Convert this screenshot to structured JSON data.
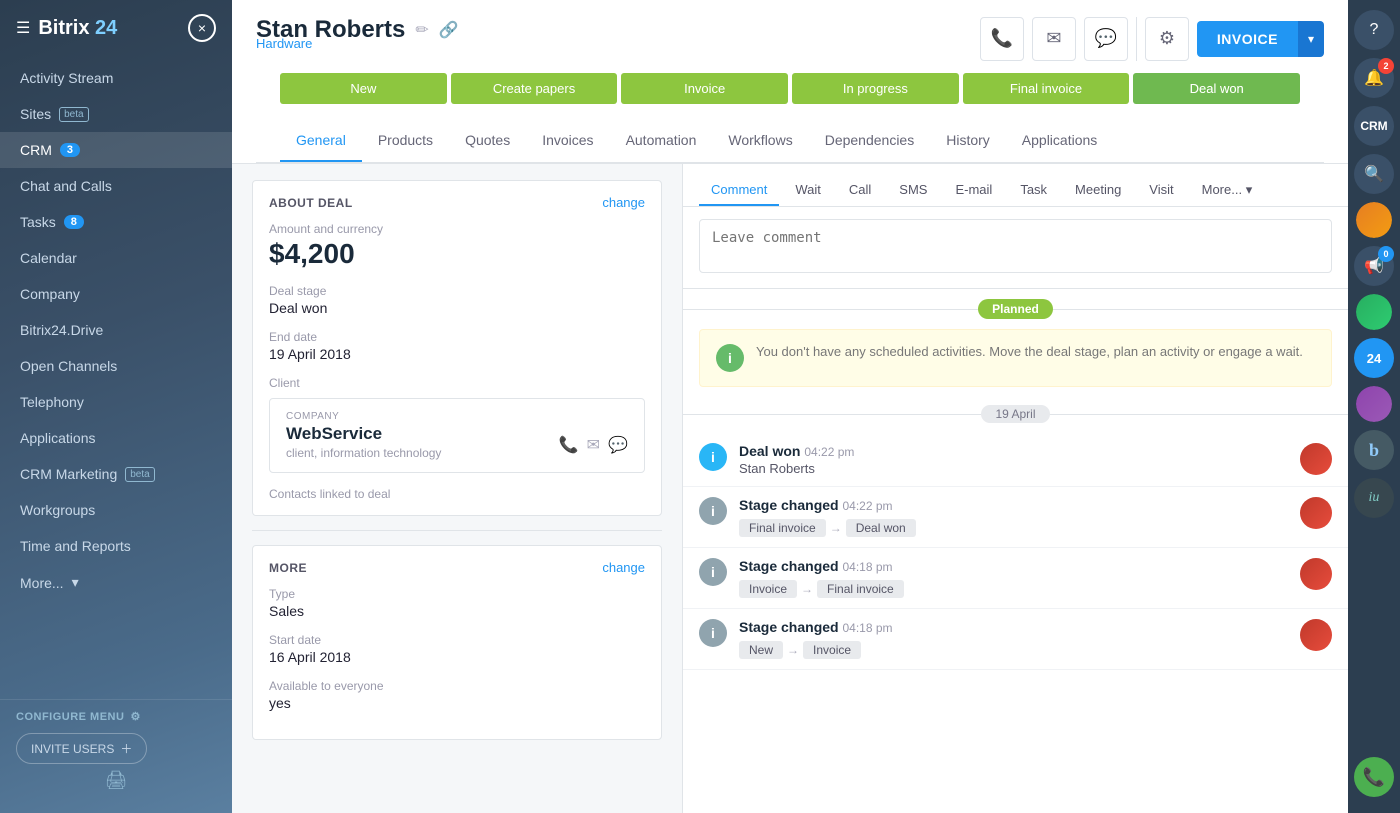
{
  "app": {
    "name": "Bitrix",
    "number": "24",
    "close_label": "×"
  },
  "sidebar": {
    "items": [
      {
        "id": "activity-stream",
        "label": "Activity Stream",
        "badge": null,
        "beta": false
      },
      {
        "id": "sites",
        "label": "Sites",
        "badge": null,
        "beta": true
      },
      {
        "id": "crm",
        "label": "CRM",
        "badge": "3",
        "beta": false,
        "active": true
      },
      {
        "id": "chat-calls",
        "label": "Chat and Calls",
        "badge": null,
        "beta": false
      },
      {
        "id": "tasks",
        "label": "Tasks",
        "badge": "8",
        "beta": false
      },
      {
        "id": "calendar",
        "label": "Calendar",
        "badge": null,
        "beta": false
      },
      {
        "id": "company",
        "label": "Company",
        "badge": null,
        "beta": false
      },
      {
        "id": "bitrix24drive",
        "label": "Bitrix24.Drive",
        "badge": null,
        "beta": false
      },
      {
        "id": "open-channels",
        "label": "Open Channels",
        "badge": null,
        "beta": false
      },
      {
        "id": "telephony",
        "label": "Telephony",
        "badge": null,
        "beta": false
      },
      {
        "id": "applications",
        "label": "Applications",
        "badge": null,
        "beta": false
      },
      {
        "id": "crm-marketing",
        "label": "CRM Marketing",
        "badge": null,
        "beta": true
      },
      {
        "id": "workgroups",
        "label": "Workgroups",
        "badge": null,
        "beta": false
      },
      {
        "id": "time-reports",
        "label": "Time and Reports",
        "badge": null,
        "beta": false
      },
      {
        "id": "more",
        "label": "More...",
        "badge": null,
        "beta": false
      }
    ],
    "configure_menu": "CONFIGURE MENU",
    "invite_users": "INVITE USERS"
  },
  "deal": {
    "title": "Stan Roberts",
    "subtitle": "Hardware",
    "pipeline_stages": [
      {
        "id": "new",
        "label": "New",
        "active": true
      },
      {
        "id": "create-papers",
        "label": "Create papers"
      },
      {
        "id": "invoice",
        "label": "Invoice"
      },
      {
        "id": "in-progress",
        "label": "In progress"
      },
      {
        "id": "final-invoice",
        "label": "Final invoice"
      },
      {
        "id": "deal-won",
        "label": "Deal won"
      }
    ],
    "tabs": [
      {
        "id": "general",
        "label": "General",
        "active": true
      },
      {
        "id": "products",
        "label": "Products"
      },
      {
        "id": "quotes",
        "label": "Quotes"
      },
      {
        "id": "invoices",
        "label": "Invoices"
      },
      {
        "id": "automation",
        "label": "Automation"
      },
      {
        "id": "workflows",
        "label": "Workflows"
      },
      {
        "id": "dependencies",
        "label": "Dependencies"
      },
      {
        "id": "history",
        "label": "History"
      },
      {
        "id": "applications",
        "label": "Applications"
      }
    ],
    "about_deal": "ABOUT DEAL",
    "change": "change",
    "amount_label": "Amount and currency",
    "amount": "$4,200",
    "deal_stage_label": "Deal stage",
    "deal_stage": "Deal won",
    "end_date_label": "End date",
    "end_date": "19 April 2018",
    "client_label": "Client",
    "company": {
      "company_label": "COMPANY",
      "name": "WebService",
      "sub": "client, information technology"
    },
    "contacts_linked": "Contacts linked to deal",
    "more_label": "MORE",
    "type_label": "Type",
    "type": "Sales",
    "start_date_label": "Start date",
    "start_date": "16 April 2018",
    "available_label": "Available to everyone",
    "available": "yes"
  },
  "activity": {
    "tabs": [
      {
        "id": "comment",
        "label": "Comment",
        "active": true
      },
      {
        "id": "wait",
        "label": "Wait"
      },
      {
        "id": "call",
        "label": "Call"
      },
      {
        "id": "sms",
        "label": "SMS"
      },
      {
        "id": "email",
        "label": "E-mail"
      },
      {
        "id": "task",
        "label": "Task"
      },
      {
        "id": "meeting",
        "label": "Meeting"
      },
      {
        "id": "visit",
        "label": "Visit"
      },
      {
        "id": "more",
        "label": "More..."
      }
    ],
    "comment_placeholder": "Leave comment",
    "planned_badge": "Planned",
    "no_activity_msg": "You don't have any scheduled activities. Move the deal stage, plan an activity or engage a wait.",
    "date_divider": "19 April",
    "timeline_items": [
      {
        "id": "deal-won-event",
        "title": "Deal won",
        "time": "04:22 pm",
        "sub": "Stan Roberts",
        "type": "info"
      },
      {
        "id": "stage-changed-1",
        "title": "Stage changed",
        "time": "04:22 pm",
        "from": "Final invoice",
        "to": "Deal won",
        "type": "info"
      },
      {
        "id": "stage-changed-2",
        "title": "Stage changed",
        "time": "04:18 pm",
        "from": "Invoice",
        "to": "Final invoice",
        "type": "info"
      },
      {
        "id": "stage-changed-3",
        "title": "Stage changed",
        "time": "04:18 pm",
        "from": "New",
        "to": "Invoice",
        "type": "info"
      }
    ]
  },
  "header_buttons": {
    "phone": "📞",
    "email": "✉",
    "chat": "💬",
    "gear": "⚙",
    "invoice": "INVOICE"
  },
  "right_panel": {
    "help": "?",
    "notifications_badge": "2",
    "online_badge": "0"
  }
}
